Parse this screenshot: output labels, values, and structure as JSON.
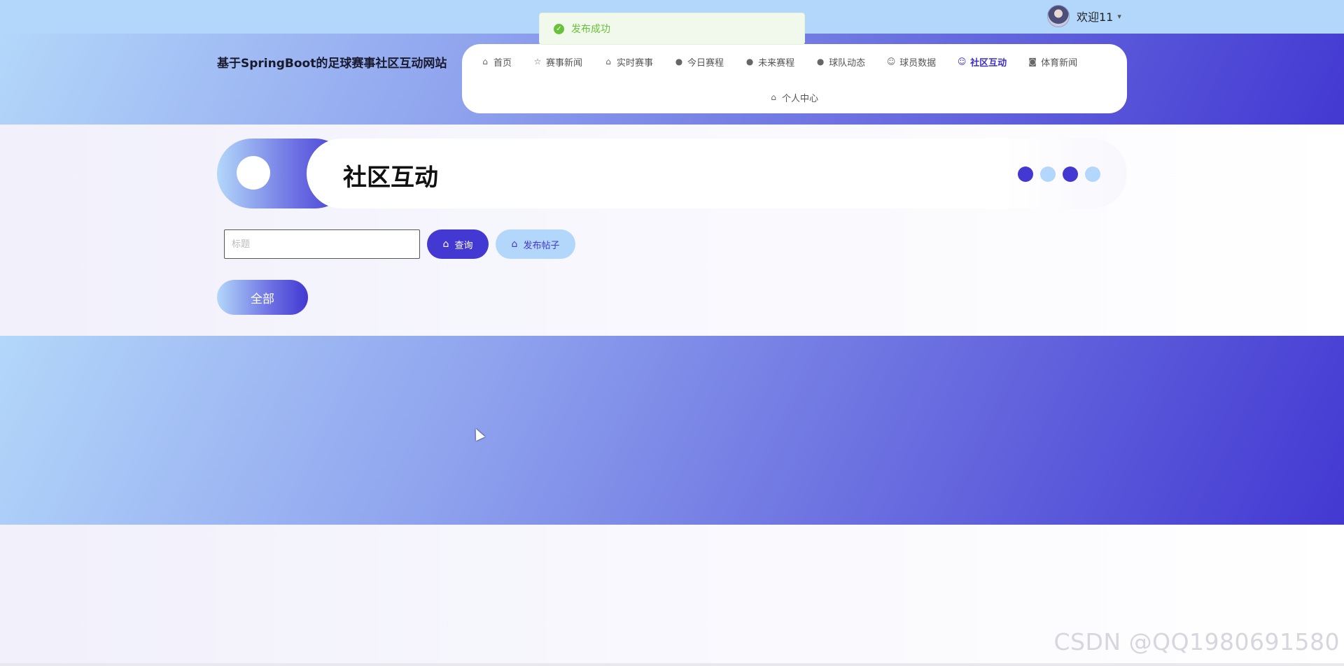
{
  "topbar": {
    "welcome": "欢迎11",
    "caret": "▾"
  },
  "toast": {
    "icon": "✓",
    "message": "发布成功"
  },
  "header": {
    "site_title": "基于SpringBoot的足球赛事社区互动网站",
    "nav": [
      {
        "label": "首页",
        "icon": "⌂"
      },
      {
        "label": "赛事新闻",
        "icon": "☆"
      },
      {
        "label": "实时赛事",
        "icon": "⌂"
      },
      {
        "label": "今日赛程",
        "icon": "●"
      },
      {
        "label": "未来赛程",
        "icon": "●"
      },
      {
        "label": "球队动态",
        "icon": "●"
      },
      {
        "label": "球员数据",
        "icon": "☺"
      },
      {
        "label": "社区互动",
        "icon": "☺"
      },
      {
        "label": "体育新闻",
        "icon": "◙"
      }
    ],
    "nav_second": {
      "label": "个人中心",
      "icon": "⌂"
    },
    "active": "社区互动"
  },
  "banner": {
    "title": "社区互动"
  },
  "search": {
    "placeholder": "标题",
    "value": "",
    "query_label": "查询",
    "post_label": "发布帖子",
    "btn_icon": "⌂"
  },
  "category": {
    "all_label": "全部"
  },
  "watermark": "CSDN @QQ1980691580",
  "colors": {
    "primary": "#4338d2",
    "light": "#b3d7fa",
    "success": "#67c23a"
  }
}
